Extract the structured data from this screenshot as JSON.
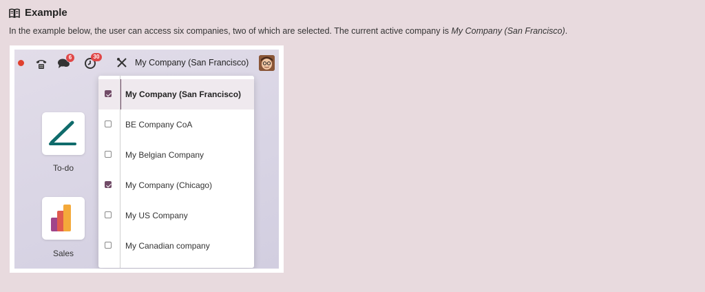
{
  "section": {
    "heading": "Example",
    "description_prefix": "In the example below, the user can access six companies, two of which are selected. The current active company is ",
    "description_company": "My Company (San Francisco)",
    "description_suffix": "."
  },
  "navbar": {
    "chat_badge": "6",
    "activity_badge": "30",
    "current_company": "My Company (San Francisco)",
    "icons": [
      "recording-dot-icon",
      "phone-icon",
      "chat-icon",
      "clock-icon",
      "tools-icon",
      "avatar"
    ]
  },
  "apps": [
    {
      "label": "To-do",
      "icon": "todo-pen-icon"
    },
    {
      "label": "Sales",
      "icon": "sales-bars-icon"
    }
  ],
  "company_dropdown": {
    "items": [
      {
        "label": "My Company (San Francisco)",
        "checked": true,
        "active": true
      },
      {
        "label": "BE Company CoA",
        "checked": false,
        "active": false
      },
      {
        "label": "My Belgian Company",
        "checked": false,
        "active": false
      },
      {
        "label": "My Company (Chicago)",
        "checked": true,
        "active": false
      },
      {
        "label": "My US Company",
        "checked": false,
        "active": false
      },
      {
        "label": "My Canadian company",
        "checked": false,
        "active": false
      }
    ]
  },
  "colors": {
    "page_background": "#e8dade",
    "accent": "#714b67",
    "badge": "#e04848",
    "record_dot": "#e0402e"
  }
}
